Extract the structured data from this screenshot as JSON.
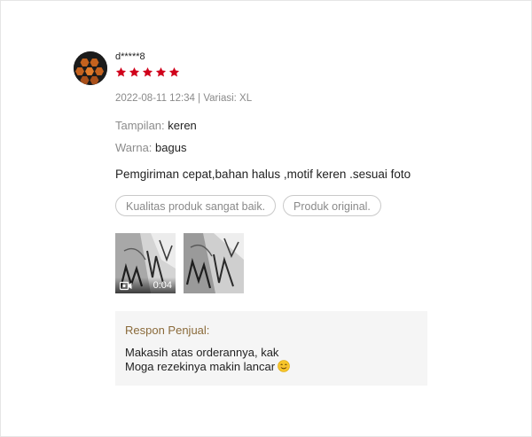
{
  "review": {
    "username": "d*****8",
    "rating": 5,
    "rating_max": 5,
    "star_color": "#d0011b",
    "date": "2022-08-11 12:34",
    "separator": " | ",
    "variant_label": "Variasi:",
    "variant_value": "XL",
    "attributes": [
      {
        "label": "Tampilan:",
        "value": "keren"
      },
      {
        "label": "Warna:",
        "value": "bagus"
      }
    ],
    "comment": "Pemgiriman cepat,bahan halus ,motif keren .sesuai foto",
    "tags": [
      "Kualitas produk sangat baik.",
      "Produk original."
    ],
    "media": [
      {
        "type": "video",
        "icon": "video-camera-icon",
        "duration": "0:04"
      },
      {
        "type": "photo"
      }
    ]
  },
  "seller_reply": {
    "title": "Respon Penjual:",
    "lines": [
      "Makasih atas orderannya, kak",
      "Moga rezekinya makin lancar"
    ],
    "emoji": "smiling-face-emoji"
  }
}
